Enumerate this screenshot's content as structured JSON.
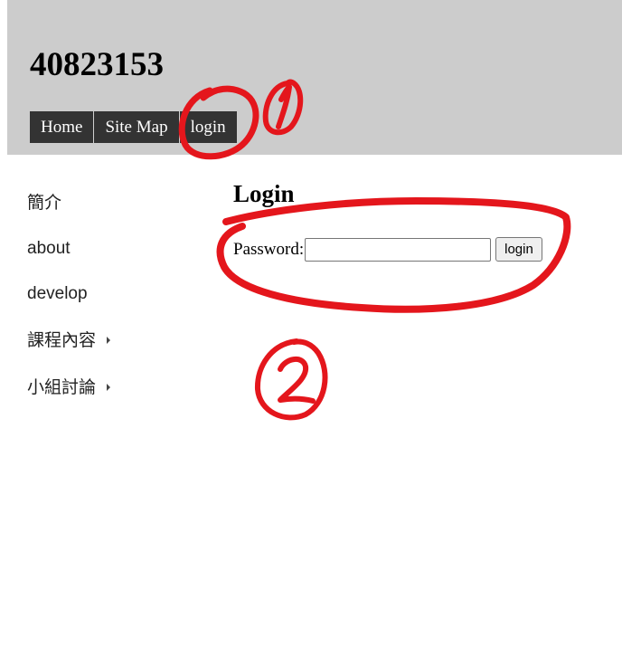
{
  "header": {
    "site_title": "40823153",
    "nav": [
      "Home",
      "Site Map",
      "login"
    ]
  },
  "sidebar": {
    "items": [
      {
        "label": "簡介",
        "has_submenu": false
      },
      {
        "label": "about",
        "has_submenu": false
      },
      {
        "label": "develop",
        "has_submenu": false
      },
      {
        "label": "課程內容",
        "has_submenu": true
      },
      {
        "label": "小組討論",
        "has_submenu": true
      }
    ]
  },
  "main": {
    "heading": "Login",
    "password_label": "Password:",
    "password_value": "",
    "login_button": "login"
  },
  "colors": {
    "header_bg": "#cccccc",
    "nav_bg": "#333333",
    "annotation": "#e4161c"
  }
}
